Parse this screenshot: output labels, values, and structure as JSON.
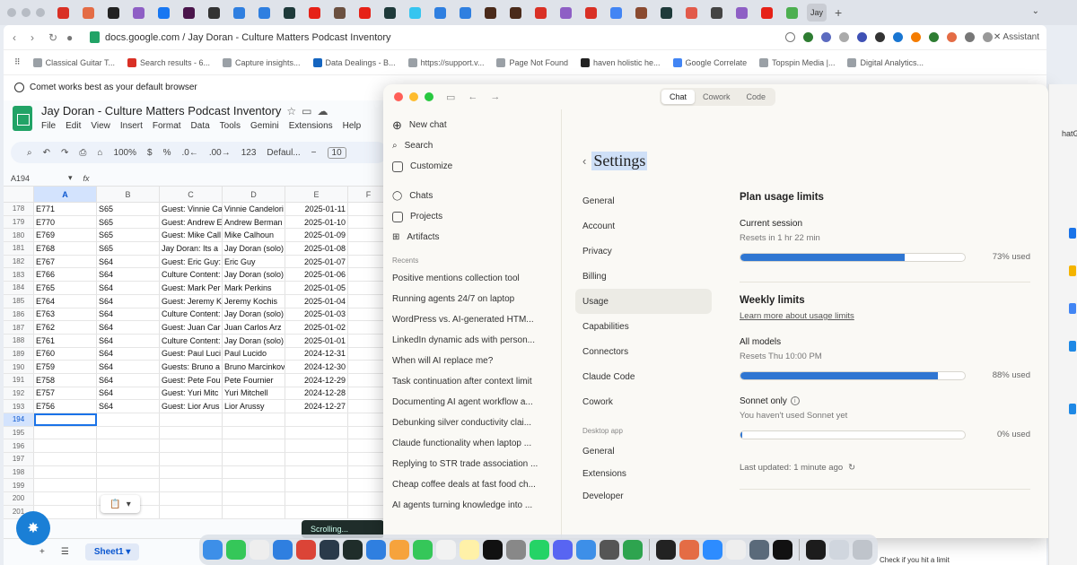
{
  "browser": {
    "profile_chip": "Jay",
    "url": "docs.google.com / Jay Doran - Culture Matters Podcast Inventory",
    "assistant_label": "Assistant",
    "bookmarks": [
      "Classical Guitar T...",
      "Search results - 6...",
      "Capture insights...",
      "Data Dealings - B...",
      "https://support.v...",
      "Page Not Found",
      "haven holistic he...",
      "Google Correlate",
      "Topspin Media |...",
      "Digital Analytics..."
    ],
    "banner": "Comet works best as your default browser"
  },
  "sheets": {
    "title": "Jay Doran - Culture Matters Podcast Inventory",
    "menus": [
      "File",
      "Edit",
      "View",
      "Insert",
      "Format",
      "Data",
      "Tools",
      "Gemini",
      "Extensions",
      "Help"
    ],
    "toolbar": {
      "zoom": "100%",
      "currency": "$",
      "percent": "%",
      "dec_less": ".0←",
      "dec_more": ".00→",
      "number_fmt": "123",
      "font": "Defaul...",
      "font_size": "10"
    },
    "name_box": "A194",
    "fx": "fx",
    "columns": [
      "A",
      "B",
      "C",
      "D",
      "E",
      "F"
    ],
    "rows": [
      {
        "n": "178",
        "a": "E771",
        "b": "S65",
        "c": "Guest: Vinnie Ca",
        "d": "Vinnie Candelori",
        "e": "2025-01-11"
      },
      {
        "n": "179",
        "a": "E770",
        "b": "S65",
        "c": "Guest: Andrew E",
        "d": "Andrew Berman",
        "e": "2025-01-10"
      },
      {
        "n": "180",
        "a": "E769",
        "b": "S65",
        "c": "Guest: Mike Call",
        "d": "Mike Calhoun",
        "e": "2025-01-09"
      },
      {
        "n": "181",
        "a": "E768",
        "b": "S65",
        "c": "Jay Doran: Its a",
        "d": "Jay Doran (solo)",
        "e": "2025-01-08"
      },
      {
        "n": "182",
        "a": "E767",
        "b": "S64",
        "c": "Guest: Eric Guy:",
        "d": "Eric Guy",
        "e": "2025-01-07"
      },
      {
        "n": "183",
        "a": "E766",
        "b": "S64",
        "c": "Culture Content:",
        "d": "Jay Doran (solo)",
        "e": "2025-01-06"
      },
      {
        "n": "184",
        "a": "E765",
        "b": "S64",
        "c": "Guest: Mark Per",
        "d": "Mark Perkins",
        "e": "2025-01-05"
      },
      {
        "n": "185",
        "a": "E764",
        "b": "S64",
        "c": "Guest: Jeremy K",
        "d": "Jeremy Kochis",
        "e": "2025-01-04"
      },
      {
        "n": "186",
        "a": "E763",
        "b": "S64",
        "c": "Culture Content:",
        "d": "Jay Doran (solo)",
        "e": "2025-01-03"
      },
      {
        "n": "187",
        "a": "E762",
        "b": "S64",
        "c": "Guest: Juan Car",
        "d": "Juan Carlos Arz",
        "e": "2025-01-02"
      },
      {
        "n": "188",
        "a": "E761",
        "b": "S64",
        "c": "Culture Content:",
        "d": "Jay Doran (solo)",
        "e": "2025-01-01"
      },
      {
        "n": "189",
        "a": "E760",
        "b": "S64",
        "c": "Guest: Paul Luci",
        "d": "Paul Lucido",
        "e": "2024-12-31"
      },
      {
        "n": "190",
        "a": "E759",
        "b": "S64",
        "c": "Guests: Bruno a",
        "d": "Bruno Marcinkov",
        "e": "2024-12-30"
      },
      {
        "n": "191",
        "a": "E758",
        "b": "S64",
        "c": "Guest: Pete Fou",
        "d": "Pete Fournier",
        "e": "2024-12-29"
      },
      {
        "n": "192",
        "a": "E757",
        "b": "S64",
        "c": "Guest: Yuri Mitc",
        "d": "Yuri Mitchell",
        "e": "2024-12-28"
      },
      {
        "n": "193",
        "a": "E756",
        "b": "S64",
        "c": "Guest: Lior Arus",
        "d": "Lior Arussy",
        "e": "2024-12-27"
      },
      {
        "n": "194",
        "a": "",
        "b": "",
        "c": "",
        "d": "",
        "e": ""
      },
      {
        "n": "195",
        "a": "",
        "b": "",
        "c": "",
        "d": "",
        "e": ""
      },
      {
        "n": "196",
        "a": "",
        "b": "",
        "c": "",
        "d": "",
        "e": ""
      },
      {
        "n": "197",
        "a": "",
        "b": "",
        "c": "",
        "d": "",
        "e": ""
      },
      {
        "n": "198",
        "a": "",
        "b": "",
        "c": "",
        "d": "",
        "e": ""
      },
      {
        "n": "199",
        "a": "",
        "b": "",
        "c": "",
        "d": "",
        "e": ""
      },
      {
        "n": "200",
        "a": "",
        "b": "",
        "c": "",
        "d": "",
        "e": ""
      },
      {
        "n": "201",
        "a": "",
        "b": "",
        "c": "",
        "d": "",
        "e": ""
      }
    ],
    "sheet_tab": "Sheet1",
    "scrolling_toast": "Scrolling..."
  },
  "claude": {
    "modes": [
      "Chat",
      "Cowork",
      "Code"
    ],
    "active_mode": "Chat",
    "sidebar": {
      "items": [
        "New chat",
        "Search",
        "Customize",
        "Chats",
        "Projects",
        "Artifacts"
      ],
      "recents_heading": "Recents",
      "recents": [
        "Positive mentions collection tool",
        "Running agents 24/7 on laptop",
        "WordPress vs. AI-generated HTM...",
        "LinkedIn dynamic ads with person...",
        "When will AI replace me?",
        "Task continuation after context limit",
        "Documenting AI agent workflow a...",
        "Debunking silver conductivity clai...",
        "Claude functionality when laptop ...",
        "Replying to STR trade association ...",
        "Cheap coffee deals at fast food ch...",
        "AI agents turning knowledge into ..."
      ]
    },
    "settings": {
      "title": "Settings",
      "nav": [
        "General",
        "Account",
        "Privacy",
        "Billing",
        "Usage",
        "Capabilities",
        "Connectors",
        "Claude Code",
        "Cowork"
      ],
      "active_nav": "Usage",
      "desktop_heading": "Desktop app",
      "desktop_nav": [
        "General",
        "Extensions",
        "Developer"
      ]
    },
    "usage": {
      "plan_heading": "Plan usage limits",
      "current_session": "Current session",
      "current_resets": "Resets in 1 hr 22 min",
      "current_pct": 0.73,
      "current_label": "73% used",
      "weekly_heading": "Weekly limits",
      "learn_more": "Learn more about usage limits",
      "all_models": "All models",
      "all_resets": "Resets Thu 10:00 PM",
      "all_pct": 0.88,
      "all_label": "88% used",
      "sonnet_only": "Sonnet only",
      "sonnet_note": "You haven't used Sonnet yet",
      "sonnet_pct": 0.0,
      "sonnet_label": "0% used",
      "updated": "Last updated: 1 minute ago"
    }
  },
  "right_window": {
    "tab_text": "hatG"
  },
  "bottom_caption": "Check if you hit a limit"
}
